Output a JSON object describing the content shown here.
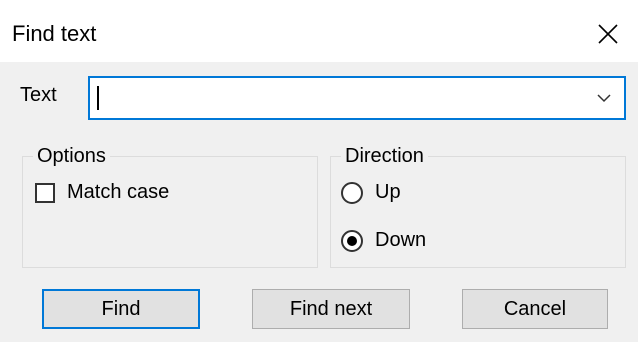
{
  "window": {
    "title": "Find text",
    "close_icon": "close-icon"
  },
  "search": {
    "label": "Text",
    "value": "",
    "dropdown_icon": "chevron-down-icon"
  },
  "options": {
    "group_label": "Options",
    "match_case_label": "Match case",
    "match_case_checked": false
  },
  "direction": {
    "group_label": "Direction",
    "items": [
      {
        "label": "Up",
        "selected": false
      },
      {
        "label": "Down",
        "selected": true
      }
    ]
  },
  "buttons": {
    "find": "Find",
    "find_next": "Find next",
    "cancel": "Cancel"
  },
  "colors": {
    "accent": "#0078d7",
    "dialog_bg": "#f0f0f0",
    "button_bg": "#e1e1e1"
  }
}
